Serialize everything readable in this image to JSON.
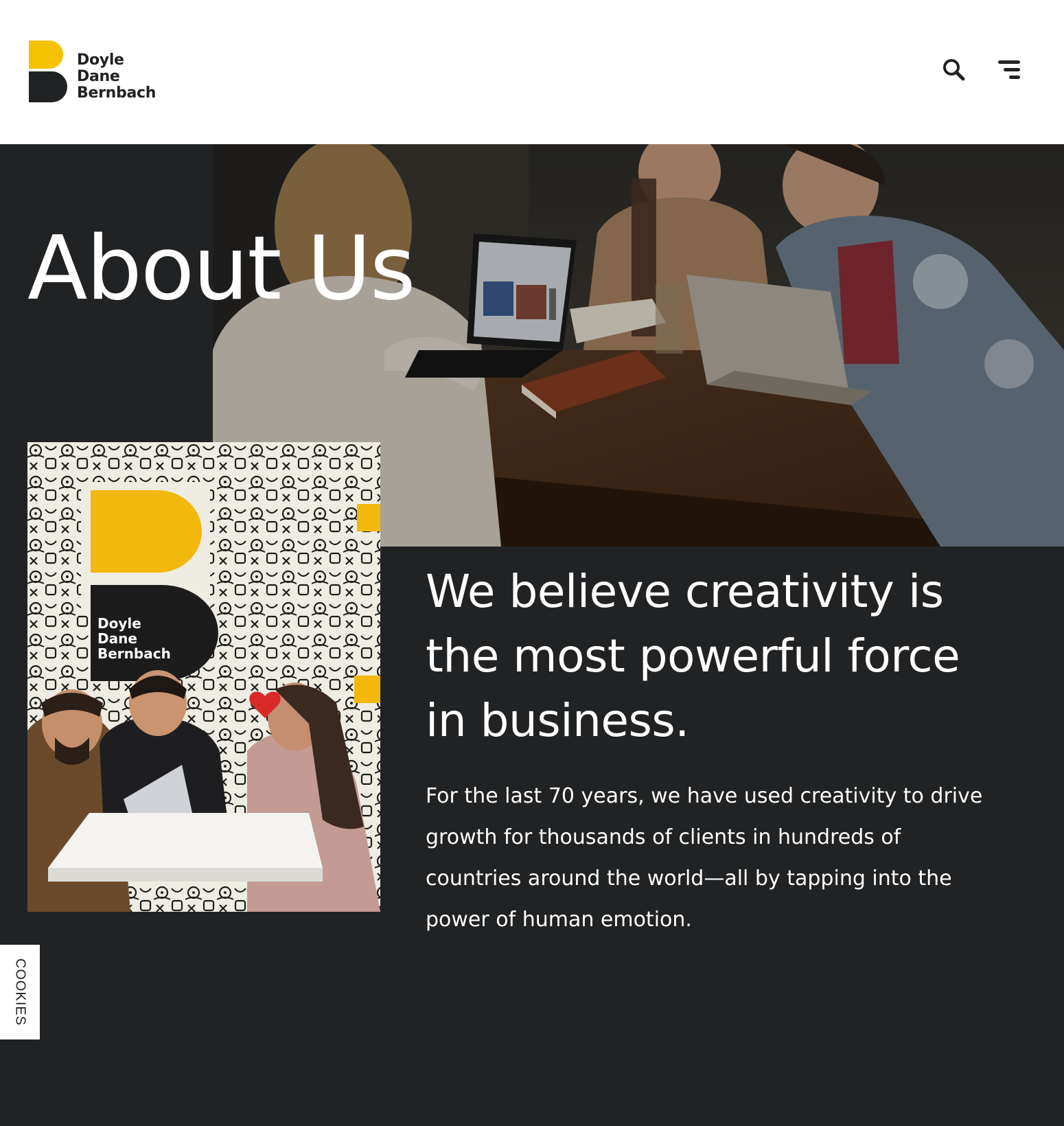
{
  "brand": {
    "line1": "Doyle",
    "line2": "Dane",
    "line3": "Bernbach",
    "accent_color": "#f5c100",
    "dark_color": "#212223"
  },
  "header": {
    "search_icon": "search-icon",
    "menu_icon": "menu-icon"
  },
  "hero": {
    "title": "About Us",
    "photo": "people-at-table-with-laptops"
  },
  "inset": {
    "photo": "team-at-table-in-front-of-logo-mural",
    "wall_logo_line1": "Doyle",
    "wall_logo_line2": "Dane",
    "wall_logo_line3": "Bernbach"
  },
  "content": {
    "headline": "We believe creativity is the most powerful force in business.",
    "body": "For the last 70 years, we have used creativity to drive growth for thousands of clients in hundreds of countries around the world—all by tapping into the power of human emotion."
  },
  "cookies": {
    "label": "COOKIES"
  }
}
